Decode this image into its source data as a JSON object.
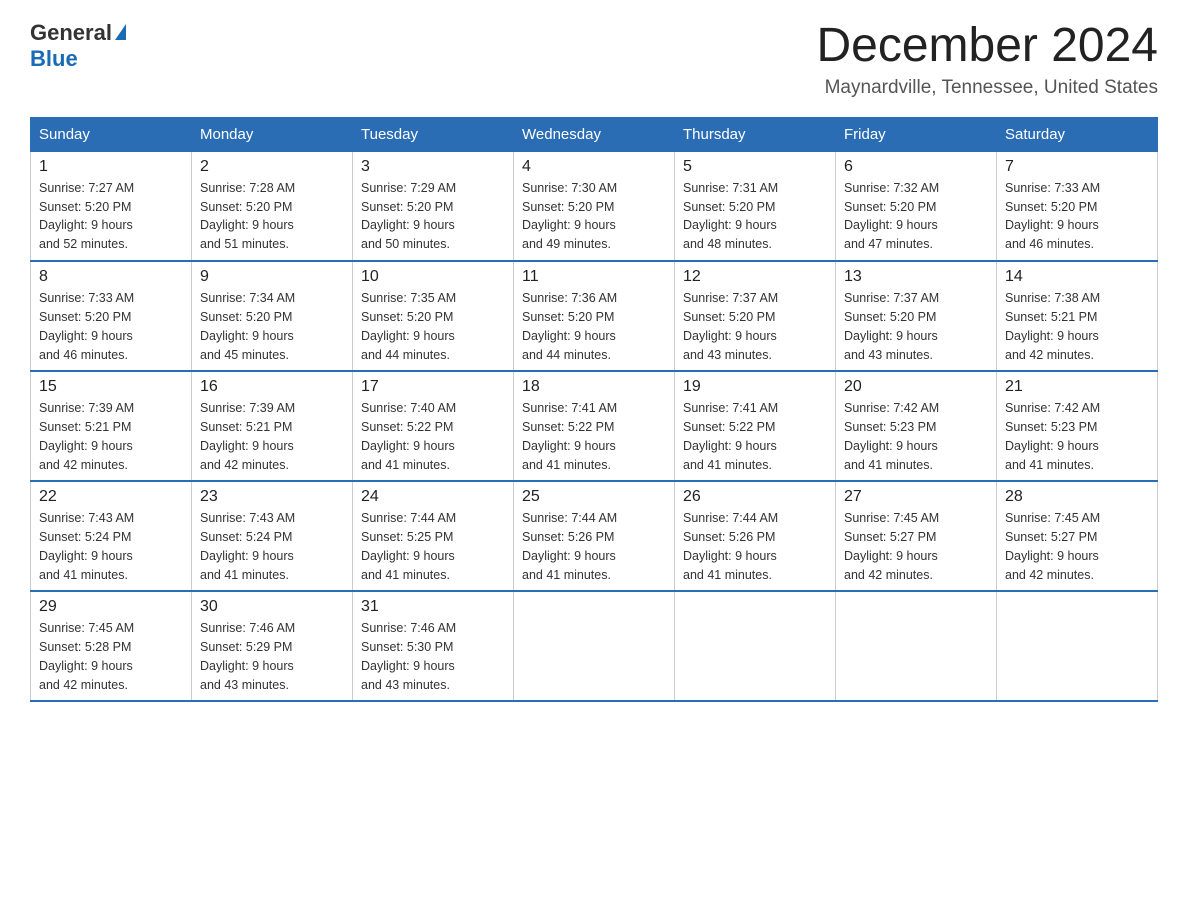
{
  "logo": {
    "general": "General",
    "blue": "Blue",
    "aria": "GeneralBlue logo"
  },
  "title": "December 2024",
  "location": "Maynardville, Tennessee, United States",
  "days_header": [
    "Sunday",
    "Monday",
    "Tuesday",
    "Wednesday",
    "Thursday",
    "Friday",
    "Saturday"
  ],
  "weeks": [
    [
      {
        "num": "1",
        "sunrise": "7:27 AM",
        "sunset": "5:20 PM",
        "daylight": "9 hours and 52 minutes."
      },
      {
        "num": "2",
        "sunrise": "7:28 AM",
        "sunset": "5:20 PM",
        "daylight": "9 hours and 51 minutes."
      },
      {
        "num": "3",
        "sunrise": "7:29 AM",
        "sunset": "5:20 PM",
        "daylight": "9 hours and 50 minutes."
      },
      {
        "num": "4",
        "sunrise": "7:30 AM",
        "sunset": "5:20 PM",
        "daylight": "9 hours and 49 minutes."
      },
      {
        "num": "5",
        "sunrise": "7:31 AM",
        "sunset": "5:20 PM",
        "daylight": "9 hours and 48 minutes."
      },
      {
        "num": "6",
        "sunrise": "7:32 AM",
        "sunset": "5:20 PM",
        "daylight": "9 hours and 47 minutes."
      },
      {
        "num": "7",
        "sunrise": "7:33 AM",
        "sunset": "5:20 PM",
        "daylight": "9 hours and 46 minutes."
      }
    ],
    [
      {
        "num": "8",
        "sunrise": "7:33 AM",
        "sunset": "5:20 PM",
        "daylight": "9 hours and 46 minutes."
      },
      {
        "num": "9",
        "sunrise": "7:34 AM",
        "sunset": "5:20 PM",
        "daylight": "9 hours and 45 minutes."
      },
      {
        "num": "10",
        "sunrise": "7:35 AM",
        "sunset": "5:20 PM",
        "daylight": "9 hours and 44 minutes."
      },
      {
        "num": "11",
        "sunrise": "7:36 AM",
        "sunset": "5:20 PM",
        "daylight": "9 hours and 44 minutes."
      },
      {
        "num": "12",
        "sunrise": "7:37 AM",
        "sunset": "5:20 PM",
        "daylight": "9 hours and 43 minutes."
      },
      {
        "num": "13",
        "sunrise": "7:37 AM",
        "sunset": "5:20 PM",
        "daylight": "9 hours and 43 minutes."
      },
      {
        "num": "14",
        "sunrise": "7:38 AM",
        "sunset": "5:21 PM",
        "daylight": "9 hours and 42 minutes."
      }
    ],
    [
      {
        "num": "15",
        "sunrise": "7:39 AM",
        "sunset": "5:21 PM",
        "daylight": "9 hours and 42 minutes."
      },
      {
        "num": "16",
        "sunrise": "7:39 AM",
        "sunset": "5:21 PM",
        "daylight": "9 hours and 42 minutes."
      },
      {
        "num": "17",
        "sunrise": "7:40 AM",
        "sunset": "5:22 PM",
        "daylight": "9 hours and 41 minutes."
      },
      {
        "num": "18",
        "sunrise": "7:41 AM",
        "sunset": "5:22 PM",
        "daylight": "9 hours and 41 minutes."
      },
      {
        "num": "19",
        "sunrise": "7:41 AM",
        "sunset": "5:22 PM",
        "daylight": "9 hours and 41 minutes."
      },
      {
        "num": "20",
        "sunrise": "7:42 AM",
        "sunset": "5:23 PM",
        "daylight": "9 hours and 41 minutes."
      },
      {
        "num": "21",
        "sunrise": "7:42 AM",
        "sunset": "5:23 PM",
        "daylight": "9 hours and 41 minutes."
      }
    ],
    [
      {
        "num": "22",
        "sunrise": "7:43 AM",
        "sunset": "5:24 PM",
        "daylight": "9 hours and 41 minutes."
      },
      {
        "num": "23",
        "sunrise": "7:43 AM",
        "sunset": "5:24 PM",
        "daylight": "9 hours and 41 minutes."
      },
      {
        "num": "24",
        "sunrise": "7:44 AM",
        "sunset": "5:25 PM",
        "daylight": "9 hours and 41 minutes."
      },
      {
        "num": "25",
        "sunrise": "7:44 AM",
        "sunset": "5:26 PM",
        "daylight": "9 hours and 41 minutes."
      },
      {
        "num": "26",
        "sunrise": "7:44 AM",
        "sunset": "5:26 PM",
        "daylight": "9 hours and 41 minutes."
      },
      {
        "num": "27",
        "sunrise": "7:45 AM",
        "sunset": "5:27 PM",
        "daylight": "9 hours and 42 minutes."
      },
      {
        "num": "28",
        "sunrise": "7:45 AM",
        "sunset": "5:27 PM",
        "daylight": "9 hours and 42 minutes."
      }
    ],
    [
      {
        "num": "29",
        "sunrise": "7:45 AM",
        "sunset": "5:28 PM",
        "daylight": "9 hours and 42 minutes."
      },
      {
        "num": "30",
        "sunrise": "7:46 AM",
        "sunset": "5:29 PM",
        "daylight": "9 hours and 43 minutes."
      },
      {
        "num": "31",
        "sunrise": "7:46 AM",
        "sunset": "5:30 PM",
        "daylight": "9 hours and 43 minutes."
      },
      null,
      null,
      null,
      null
    ]
  ],
  "cell_labels": {
    "sunrise": "Sunrise:",
    "sunset": "Sunset:",
    "daylight": "Daylight:"
  }
}
